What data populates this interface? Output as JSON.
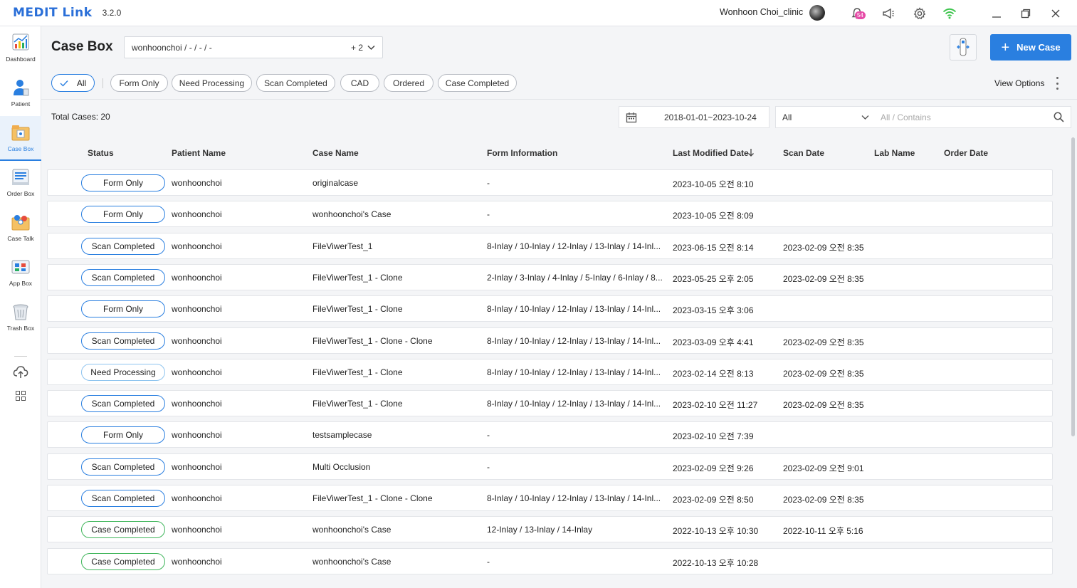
{
  "app": {
    "logo": "MEDIT Link",
    "version": "3.2.0",
    "user": "Wonhoon  Choi_clinic",
    "notification_count": "54"
  },
  "colors": {
    "accent": "#2a7fe0",
    "pill_blue": "#2a7fe0",
    "pill_light": "#8ec4ef",
    "pill_green": "#3fb55a"
  },
  "sidebar": {
    "items": [
      {
        "label": "Dashboard",
        "icon": "dashboard-icon"
      },
      {
        "label": "Patient",
        "icon": "patient-icon"
      },
      {
        "label": "Case Box",
        "icon": "case-box-icon",
        "active": true
      },
      {
        "label": "Order Box",
        "icon": "order-box-icon"
      },
      {
        "label": "Case Talk",
        "icon": "case-talk-icon"
      },
      {
        "label": "App Box",
        "icon": "app-box-icon"
      },
      {
        "label": "Trash Box",
        "icon": "trash-box-icon"
      }
    ]
  },
  "header": {
    "title": "Case Box",
    "clinic_filter": "wonhoonchoi / - / - / -",
    "clinic_more": "+ 2",
    "new_case_label": "New Case"
  },
  "filters": {
    "chips": [
      "All",
      "Form Only",
      "Need Processing",
      "Scan Completed",
      "CAD",
      "Ordered",
      "Case Completed"
    ],
    "selected": "All",
    "view_options": "View Options"
  },
  "toolbar": {
    "total_cases": "Total Cases: 20",
    "date_range": "2018-01-01~2023-10-24",
    "field_select": "All",
    "search_placeholder": "All / Contains"
  },
  "table": {
    "columns": [
      "Status",
      "Patient Name",
      "Case Name",
      "Form Information",
      "Last Modified Date",
      "Scan Date",
      "Lab Name",
      "Order Date"
    ],
    "sort_column": "Last Modified Date",
    "rows": [
      {
        "status": "Form Only",
        "patient": "wonhoonchoi",
        "case": "originalcase",
        "form": "-",
        "modified": "2023-10-05 오전 8:10",
        "scan": "",
        "lab": "",
        "order": ""
      },
      {
        "status": "Form Only",
        "patient": "wonhoonchoi",
        "case": "wonhoonchoi's Case",
        "form": "-",
        "modified": "2023-10-05 오전 8:09",
        "scan": "",
        "lab": "",
        "order": ""
      },
      {
        "status": "Scan Completed",
        "patient": "wonhoonchoi",
        "case": "FileViwerTest_1",
        "form": "8-Inlay / 10-Inlay / 12-Inlay / 13-Inlay / 14-Inl...",
        "modified": "2023-06-15 오전 8:14",
        "scan": "2023-02-09 오전 8:35",
        "lab": "",
        "order": ""
      },
      {
        "status": "Scan Completed",
        "patient": "wonhoonchoi",
        "case": "FileViwerTest_1 - Clone",
        "form": "2-Inlay / 3-Inlay / 4-Inlay / 5-Inlay / 6-Inlay / 8...",
        "modified": "2023-05-25 오후 2:05",
        "scan": "2023-02-09 오전 8:35",
        "lab": "",
        "order": ""
      },
      {
        "status": "Form Only",
        "patient": "wonhoonchoi",
        "case": "FileViwerTest_1 - Clone",
        "form": "8-Inlay / 10-Inlay / 12-Inlay / 13-Inlay / 14-Inl...",
        "modified": "2023-03-15 오후 3:06",
        "scan": "",
        "lab": "",
        "order": ""
      },
      {
        "status": "Scan Completed",
        "patient": "wonhoonchoi",
        "case": "FileViwerTest_1 - Clone - Clone",
        "form": "8-Inlay / 10-Inlay / 12-Inlay / 13-Inlay / 14-Inl...",
        "modified": "2023-03-09 오후 4:41",
        "scan": "2023-02-09 오전 8:35",
        "lab": "",
        "order": ""
      },
      {
        "status": "Need Processing",
        "patient": "wonhoonchoi",
        "case": "FileViwerTest_1 - Clone",
        "form": "8-Inlay / 10-Inlay / 12-Inlay / 13-Inlay / 14-Inl...",
        "modified": "2023-02-14 오전 8:13",
        "scan": "2023-02-09 오전 8:35",
        "lab": "",
        "order": ""
      },
      {
        "status": "Scan Completed",
        "patient": "wonhoonchoi",
        "case": "FileViwerTest_1 - Clone",
        "form": "8-Inlay / 10-Inlay / 12-Inlay / 13-Inlay / 14-Inl...",
        "modified": "2023-02-10 오전 11:27",
        "scan": "2023-02-09 오전 8:35",
        "lab": "",
        "order": ""
      },
      {
        "status": "Form Only",
        "patient": "wonhoonchoi",
        "case": "testsamplecase",
        "form": "-",
        "modified": "2023-02-10 오전 7:39",
        "scan": "",
        "lab": "",
        "order": ""
      },
      {
        "status": "Scan Completed",
        "patient": "wonhoonchoi",
        "case": "Multi Occlusion",
        "form": "-",
        "modified": "2023-02-09 오전 9:26",
        "scan": "2023-02-09 오전 9:01",
        "lab": "",
        "order": ""
      },
      {
        "status": "Scan Completed",
        "patient": "wonhoonchoi",
        "case": "FileViwerTest_1 - Clone - Clone",
        "form": "8-Inlay / 10-Inlay / 12-Inlay / 13-Inlay / 14-Inl...",
        "modified": "2023-02-09 오전 8:50",
        "scan": "2023-02-09 오전 8:35",
        "lab": "",
        "order": ""
      },
      {
        "status": "Case Completed",
        "patient": "wonhoonchoi",
        "case": "wonhoonchoi's Case",
        "form": "12-Inlay / 13-Inlay / 14-Inlay",
        "modified": "2022-10-13 오후 10:30",
        "scan": "2022-10-11 오후 5:16",
        "lab": "",
        "order": ""
      },
      {
        "status": "Case Completed",
        "patient": "wonhoonchoi",
        "case": "wonhoonchoi's Case",
        "form": "-",
        "modified": "2022-10-13 오후 10:28",
        "scan": "",
        "lab": "",
        "order": ""
      }
    ]
  }
}
